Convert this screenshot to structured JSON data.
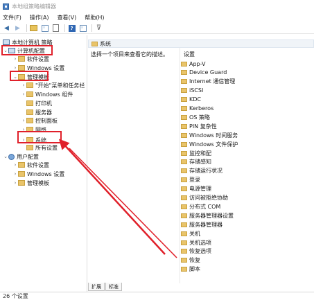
{
  "window": {
    "title": "本地组策略编辑器"
  },
  "menu": [
    "文件(F)",
    "操作(A)",
    "查看(V)",
    "帮助(H)"
  ],
  "toolbar": {
    "back_icon": "arrow-left-icon",
    "forward_icon": "arrow-right-icon"
  },
  "tree": {
    "root": "本地计算机 策略",
    "computer_config": "计算机配置",
    "software_settings": "软件设置",
    "windows_settings": "Windows 设置",
    "admin_templates": "管理模板",
    "start_menu": "\"开始\"菜单和任务栏",
    "windows_components": "Windows 组件",
    "printers": "打印机",
    "server": "服务器",
    "control_panel": "控制面板",
    "network": "网络",
    "system": "系统",
    "all_settings": "所有设置",
    "user_config": "用户配置",
    "user_software": "软件设置",
    "user_windows": "Windows 设置",
    "user_admin": "管理模板"
  },
  "right": {
    "header": "系统",
    "description": "选择一个项目来查看它的描述。",
    "column_header": "设置",
    "items": [
      "App-V",
      "Device Guard",
      "Internet 通信管理",
      "iSCSI",
      "KDC",
      "Kerberos",
      "OS 策略",
      "PIN 复杂性",
      "Windows 时间服务",
      "Windows 文件保护",
      "监控和配",
      "存储感知",
      "存储运行状况",
      "登录",
      "电源管理",
      "访问被拒绝协助",
      "分布式 COM",
      "服务器管理器设置",
      "服务器管理器",
      "关机",
      "关机选项",
      "恢复选项",
      "恢复",
      "脚本"
    ]
  },
  "tabs": [
    "扩展",
    "标准"
  ],
  "status": "26 个设置",
  "colors": {
    "highlight": "#e0202a"
  }
}
